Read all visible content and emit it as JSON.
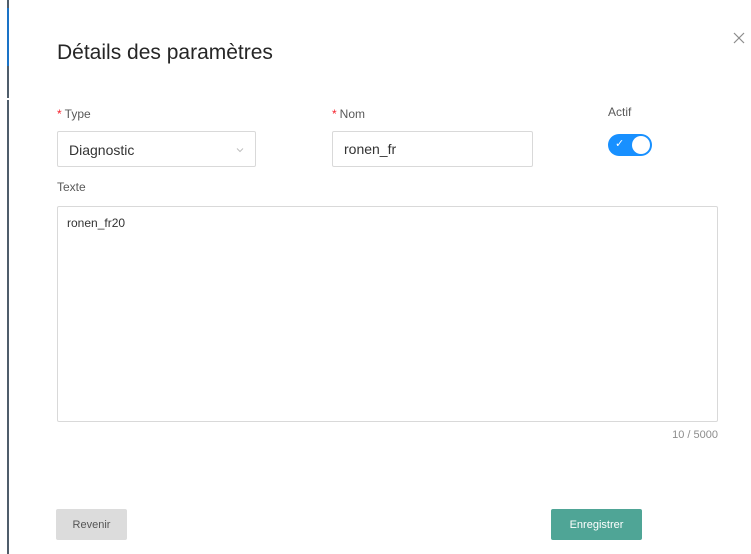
{
  "dialog": {
    "title": "Détails des paramètres",
    "close_glyph": "×"
  },
  "form": {
    "type": {
      "required_mark": "*",
      "label": "Type",
      "value": "Diagnostic"
    },
    "name": {
      "required_mark": "*",
      "label": "Nom",
      "value": "ronen_fr"
    },
    "active": {
      "label": "Actif",
      "checked": true,
      "check_glyph": "✓"
    },
    "text": {
      "label": "Texte",
      "value": "ronen_fr20",
      "counter": "10 / 5000"
    }
  },
  "footer": {
    "back_label": "Revenir",
    "save_label": "Enregistrer"
  },
  "colors": {
    "primary": "#1890ff",
    "save_button": "#4fa596",
    "required": "#f5222d"
  },
  "icons": {
    "close": "close-icon",
    "select_arrow": "chevron-down-icon",
    "switch_check": "check-icon"
  }
}
